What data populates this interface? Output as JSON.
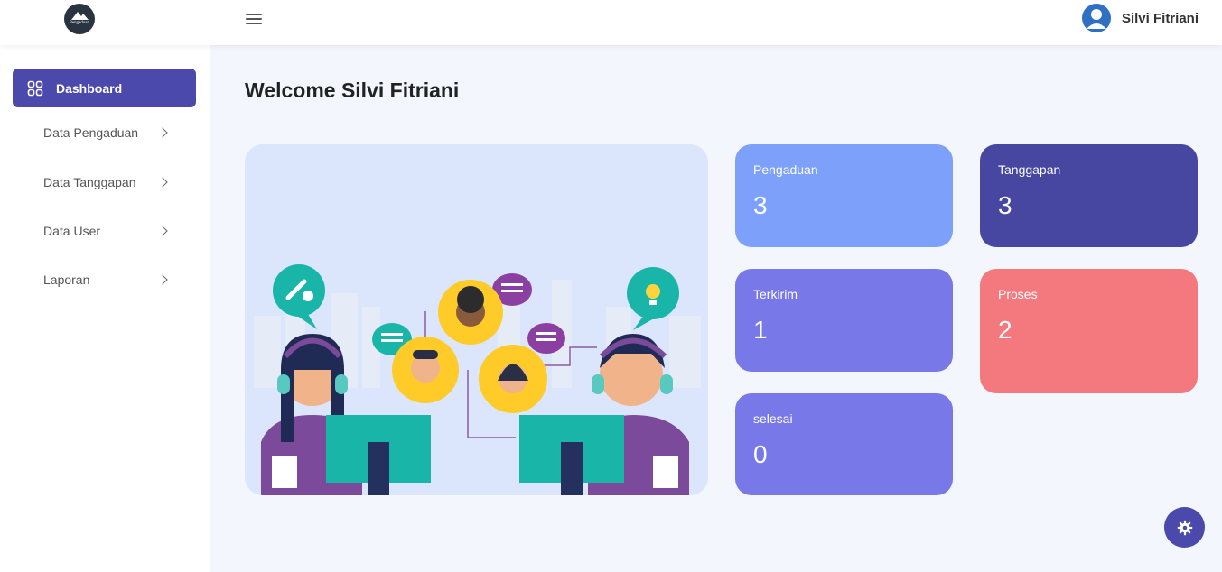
{
  "header": {
    "logo_text": "Pengaduan",
    "user_name": "Silvi Fitriani"
  },
  "sidebar": {
    "items": [
      {
        "label": "Dashboard",
        "active": true
      },
      {
        "label": "Data Pengaduan"
      },
      {
        "label": "Data Tanggapan"
      },
      {
        "label": "Data User"
      },
      {
        "label": "Laporan"
      }
    ]
  },
  "main": {
    "welcome": "Welcome Silvi Fitriani",
    "cards": [
      {
        "label": "Pengaduan",
        "value": "3",
        "color": "#7da0fa"
      },
      {
        "label": "Tanggapan",
        "value": "3",
        "color": "#4747a1"
      },
      {
        "label": "Terkirim",
        "value": "1",
        "color": "#7978e9"
      },
      {
        "label": "Proses",
        "value": "2",
        "color": "#f3797e"
      },
      {
        "label": "selesai",
        "value": "0",
        "color": "#7978e9"
      }
    ]
  },
  "colors": {
    "accent": "#4b49ac",
    "background": "#f4f6fd"
  },
  "icons": {
    "menu": "hamburger-icon",
    "dashboard": "grid-icon",
    "settings": "gear-icon",
    "user": "user-avatar-icon"
  }
}
